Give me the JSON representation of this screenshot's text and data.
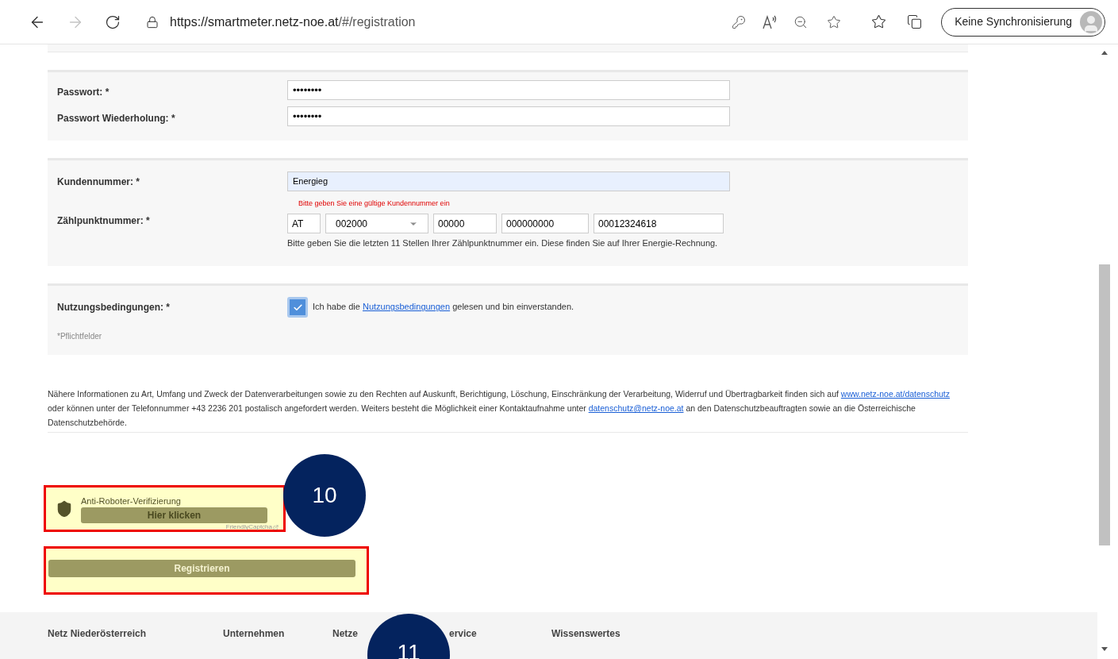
{
  "browser": {
    "url_host": "https://smartmeter.netz-noe.at",
    "url_path": "/#/registration",
    "profile_label": "Keine Synchronisierung",
    "forward_disabled": true
  },
  "password_section": {
    "fields": [
      {
        "label": "Passwort: *",
        "value": "••••••••"
      },
      {
        "label": "Passwort Wiederholung: *",
        "value": "••••••••"
      }
    ]
  },
  "customer_section": {
    "customer_number": {
      "label": "Kundennummer: *",
      "value": "Energieg",
      "error": "Bitte geben Sie eine gültige Kundennummer ein"
    },
    "meter_point": {
      "label": "Zählpunktnummer: *",
      "parts": [
        {
          "kind": "text",
          "value": "AT"
        },
        {
          "kind": "select",
          "value": "002000"
        },
        {
          "kind": "text",
          "value": "00000"
        },
        {
          "kind": "text",
          "value": "000000000"
        },
        {
          "kind": "text",
          "value": "00012324618"
        }
      ],
      "hint": "Bitte geben Sie die letzten 11 Stellen Ihrer Zählpunktnummer ein. Diese finden Sie auf Ihrer Energie-Rechnung."
    }
  },
  "terms_section": {
    "label": "Nutzungsbedingungen: *",
    "checked": true,
    "text_before": "Ich habe die",
    "link": "Nutzungsbedingungen",
    "text_after": "gelesen und bin einverstanden.",
    "required_note": "*Pflichtfelder"
  },
  "privacy_text": [
    {
      "kind": "text",
      "text": "Nähere Informationen zu Art, Umfang und Zweck der Datenverarbeitungen sowie zu den Rechten auf Auskunft, Berichtigung, Löschung, Einschränkung der Verarbeitung, Widerruf und Übertragbarkeit finden sich auf"
    },
    {
      "kind": "link",
      "text": "www.netz-noe.at/datenschutz"
    },
    {
      "kind": "text",
      "text": "oder können unter der Telefonnummer +43 2236 201 postalisch angefordert werden. Weiters besteht die Möglichkeit einer Kontaktaufnahme unter"
    },
    {
      "kind": "link",
      "text": "datenschutz@netz-noe.at"
    },
    {
      "kind": "text",
      "text": "an den Datenschutzbeauftragten sowie an die Österreichische Datenschutzbehörde."
    }
  ],
  "captcha": {
    "title": "Anti-Roboter-Verifizierung",
    "button": "Hier klicken",
    "brand": "FriendlyCaptcha"
  },
  "register_button": "Registrieren",
  "callouts": [
    {
      "number": "10"
    },
    {
      "number": "11"
    }
  ],
  "footer": {
    "columns": [
      "Netz Niederösterreich",
      "Unternehmen",
      "Netze",
      "ervice",
      "Wissenswertes"
    ]
  }
}
